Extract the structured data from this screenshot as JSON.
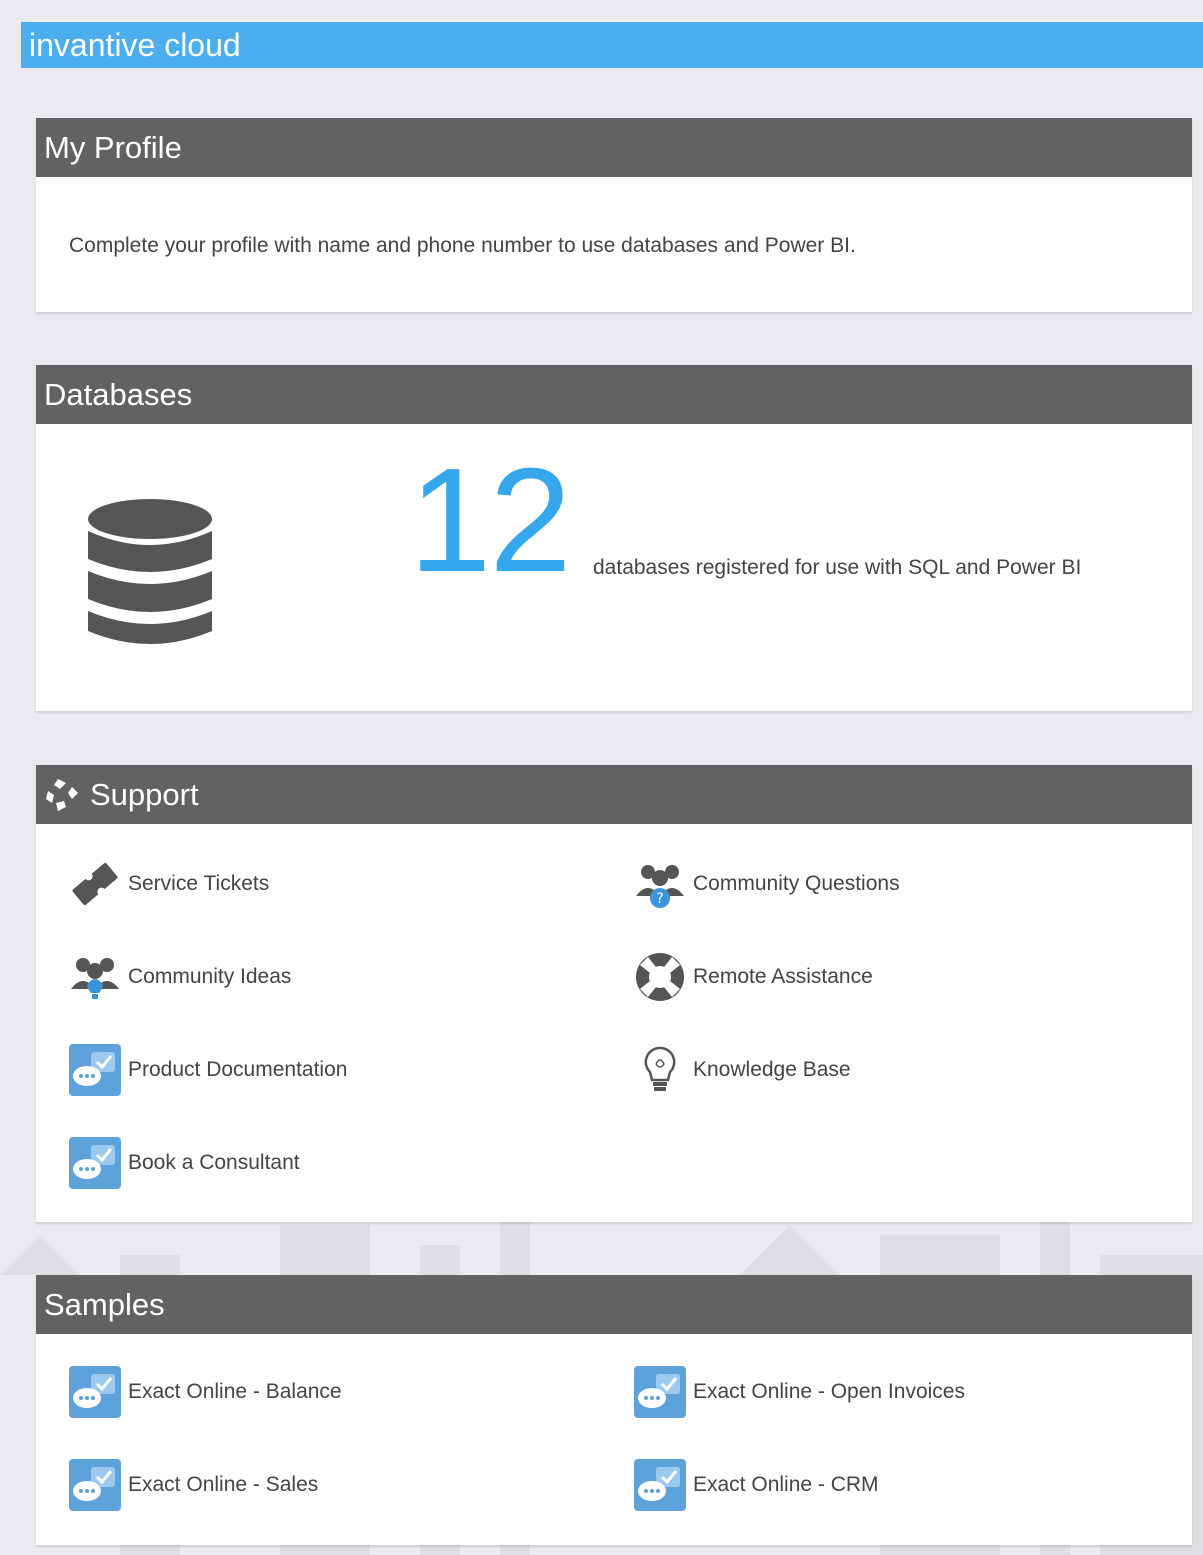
{
  "app": {
    "title": "invantive cloud"
  },
  "profile": {
    "heading": "My Profile",
    "message": "Complete your profile with name and phone number to use databases and Power BI."
  },
  "databases": {
    "heading": "Databases",
    "count": "12",
    "description": "databases registered for use with SQL and Power BI"
  },
  "support": {
    "heading": "Support",
    "items": [
      {
        "label": "Service Tickets",
        "icon": "ticket-icon"
      },
      {
        "label": "Community Questions",
        "icon": "community-questions-icon"
      },
      {
        "label": "Community Ideas",
        "icon": "community-ideas-icon"
      },
      {
        "label": "Remote Assistance",
        "icon": "lifebuoy-icon"
      },
      {
        "label": "Product Documentation",
        "icon": "chat-tile-icon"
      },
      {
        "label": "Knowledge Base",
        "icon": "lightbulb-icon"
      },
      {
        "label": "Book a Consultant",
        "icon": "chat-tile-icon"
      }
    ]
  },
  "samples": {
    "heading": "Samples",
    "items": [
      {
        "label": "Exact Online - Balance",
        "icon": "chat-tile-icon"
      },
      {
        "label": "Exact Online - Open Invoices",
        "icon": "chat-tile-icon"
      },
      {
        "label": "Exact Online - Sales",
        "icon": "chat-tile-icon"
      },
      {
        "label": "Exact Online - CRM",
        "icon": "chat-tile-icon"
      }
    ]
  },
  "colors": {
    "topbar": "#4aaeef",
    "panel_header": "#626262",
    "accent_number": "#35a7ec",
    "page_background": "#e9ebee"
  }
}
